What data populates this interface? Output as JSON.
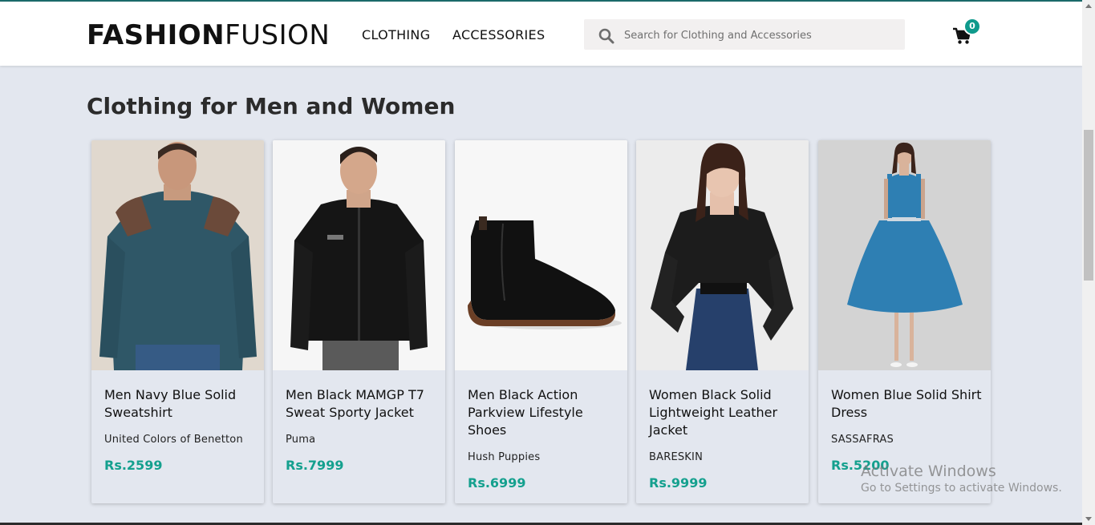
{
  "header": {
    "logo_bold": "FASHION",
    "logo_light": "FUSION",
    "nav": [
      "CLOTHING",
      "ACCESSORIES"
    ],
    "search": {
      "placeholder": "Search for Clothing and Accessories",
      "value": ""
    },
    "cart": {
      "count": "0"
    }
  },
  "main": {
    "title": "Clothing for Men and Women",
    "products": [
      {
        "name": "Men Navy Blue Solid Sweatshirt",
        "brand": "United Colors of Benetton",
        "price": "Rs.2599"
      },
      {
        "name": "Men Black MAMGP T7 Sweat Sporty Jacket",
        "brand": "Puma",
        "price": "Rs.7999"
      },
      {
        "name": "Men Black Action Parkview Lifestyle Shoes",
        "brand": "Hush Puppies",
        "price": "Rs.6999"
      },
      {
        "name": "Women Black Solid Lightweight Leather Jacket",
        "brand": "BARESKIN",
        "price": "Rs.9999"
      },
      {
        "name": "Women Blue Solid Shirt Dress",
        "brand": "SASSAFRAS",
        "price": "Rs.5200"
      }
    ]
  },
  "watermark": {
    "line1": "Activate Windows",
    "line2": "Go to Settings to activate Windows."
  },
  "colors": {
    "accent": "#14a08e",
    "page_bg": "#e3e7ef",
    "header_bg": "#ffffff"
  }
}
